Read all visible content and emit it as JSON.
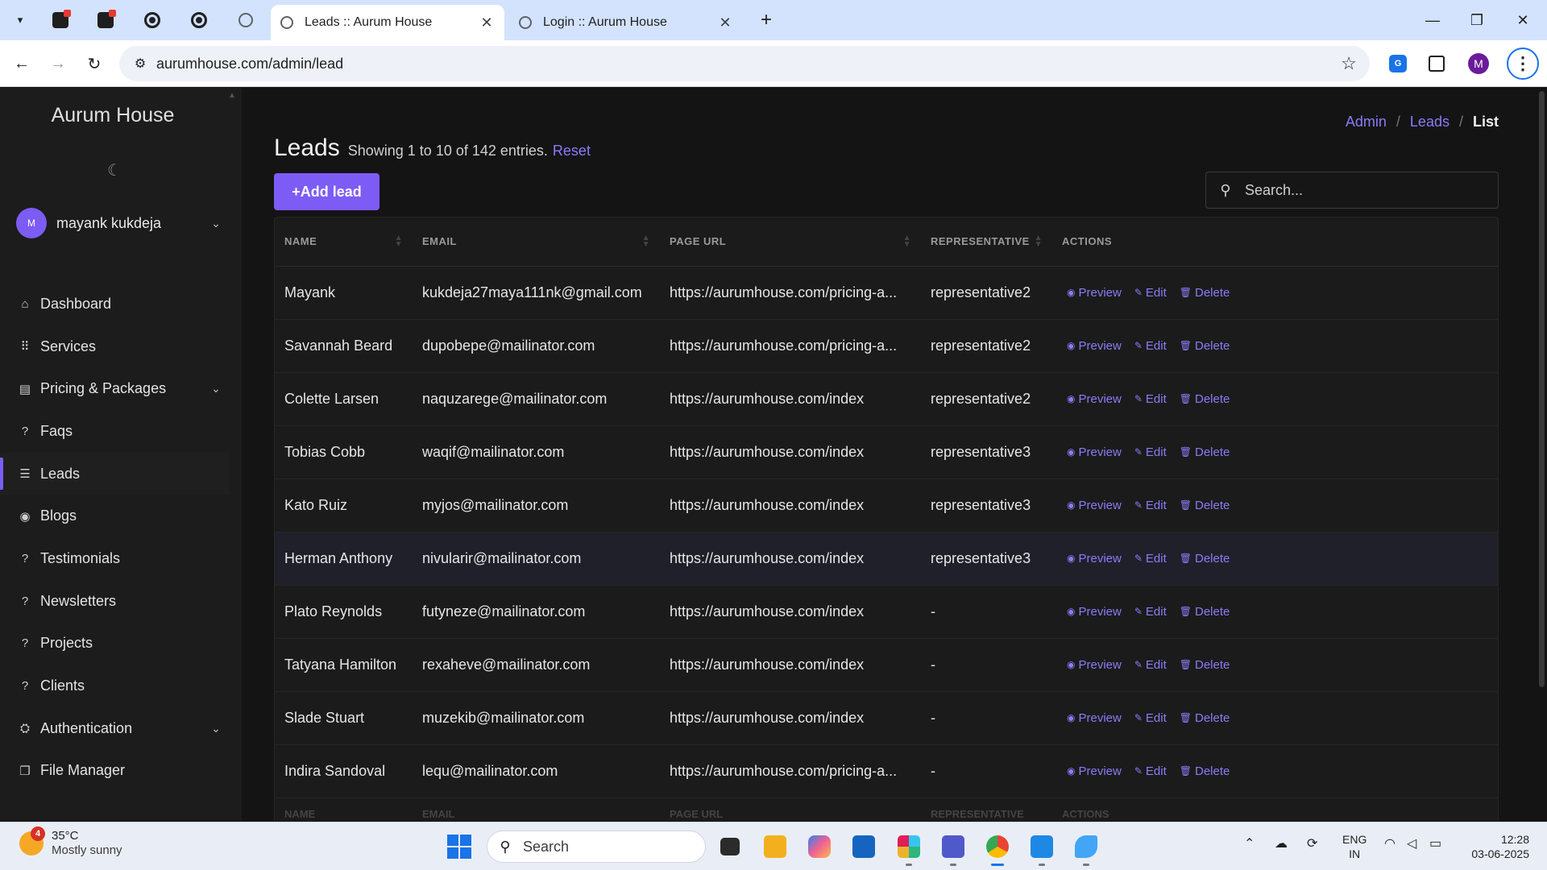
{
  "browser": {
    "tabs": [
      {
        "title": "Leads :: Aurum House",
        "active": true
      },
      {
        "title": "Login :: Aurum House",
        "active": false
      }
    ],
    "url": "aurumhouse.com/admin/lead",
    "profile_initial": "M",
    "translate_label": "G"
  },
  "sidebar": {
    "brand": "Aurum House",
    "user": {
      "initial": "M",
      "name": "mayank kukdeja"
    },
    "items": [
      {
        "label": "Dashboard",
        "icon": "home-icon",
        "glyph": "⌂",
        "expandable": false,
        "active": false
      },
      {
        "label": "Services",
        "icon": "grid-dots-icon",
        "glyph": "⠿",
        "expandable": false,
        "active": false
      },
      {
        "label": "Pricing & Packages",
        "icon": "package-icon",
        "glyph": "▤",
        "expandable": true,
        "active": false
      },
      {
        "label": "Faqs",
        "icon": "question-icon",
        "glyph": "?",
        "expandable": false,
        "active": false
      },
      {
        "label": "Leads",
        "icon": "leads-icon",
        "glyph": "☰",
        "expandable": false,
        "active": true
      },
      {
        "label": "Blogs",
        "icon": "rss-icon",
        "glyph": "◉",
        "expandable": false,
        "active": false
      },
      {
        "label": "Testimonials",
        "icon": "question-icon",
        "glyph": "?",
        "expandable": false,
        "active": false
      },
      {
        "label": "Newsletters",
        "icon": "question-icon",
        "glyph": "?",
        "expandable": false,
        "active": false
      },
      {
        "label": "Projects",
        "icon": "question-icon",
        "glyph": "?",
        "expandable": false,
        "active": false
      },
      {
        "label": "Clients",
        "icon": "question-icon",
        "glyph": "?",
        "expandable": false,
        "active": false
      },
      {
        "label": "Authentication",
        "icon": "shield-icon",
        "glyph": "⛭",
        "expandable": true,
        "active": false
      },
      {
        "label": "File Manager",
        "icon": "folder-icon",
        "glyph": "❐",
        "expandable": false,
        "active": false
      }
    ]
  },
  "breadcrumb": {
    "items": [
      "Admin",
      "Leads"
    ],
    "separator": "/",
    "current": "List"
  },
  "header": {
    "title": "Leads",
    "info": "Showing 1 to 10 of 142 entries.",
    "reset": "Reset",
    "add_button": "+Add lead",
    "search_placeholder": "Search..."
  },
  "table": {
    "columns": [
      "NAME",
      "EMAIL",
      "PAGE URL",
      "REPRESENTATIVE",
      "ACTIONS"
    ],
    "actions": {
      "preview": "Preview",
      "edit": "Edit",
      "delete": "Delete"
    },
    "rows": [
      {
        "name": "Mayank",
        "email": "kukdeja27maya111nk@gmail.com",
        "url": "https://aurumhouse.com/pricing-a...",
        "rep": "representative2"
      },
      {
        "name": "Savannah Beard",
        "email": "dupobepe@mailinator.com",
        "url": "https://aurumhouse.com/pricing-a...",
        "rep": "representative2"
      },
      {
        "name": "Colette Larsen",
        "email": "naquzarege@mailinator.com",
        "url": "https://aurumhouse.com/index",
        "rep": "representative2"
      },
      {
        "name": "Tobias Cobb",
        "email": "waqif@mailinator.com",
        "url": "https://aurumhouse.com/index",
        "rep": "representative3"
      },
      {
        "name": "Kato Ruiz",
        "email": "myjos@mailinator.com",
        "url": "https://aurumhouse.com/index",
        "rep": "representative3"
      },
      {
        "name": "Herman Anthony",
        "email": "nivularir@mailinator.com",
        "url": "https://aurumhouse.com/index",
        "rep": "representative3"
      },
      {
        "name": "Plato Reynolds",
        "email": "futyneze@mailinator.com",
        "url": "https://aurumhouse.com/index",
        "rep": "-"
      },
      {
        "name": "Tatyana Hamilton",
        "email": "rexaheve@mailinator.com",
        "url": "https://aurumhouse.com/index",
        "rep": "-"
      },
      {
        "name": "Slade Stuart",
        "email": "muzekib@mailinator.com",
        "url": "https://aurumhouse.com/index",
        "rep": "-"
      },
      {
        "name": "Indira Sandoval",
        "email": "lequ@mailinator.com",
        "url": "https://aurumhouse.com/pricing-a...",
        "rep": "-"
      }
    ]
  },
  "taskbar": {
    "weather": {
      "badge": "4",
      "temp": "35°C",
      "desc": "Mostly sunny"
    },
    "search": "Search",
    "lang": [
      "ENG",
      "IN"
    ],
    "time": "12:28",
    "date": "03-06-2025"
  },
  "colors": {
    "accent": "#7c5cf5",
    "link": "#8b7bf7",
    "background": "#141414",
    "sidebar": "#1c1c1c"
  }
}
